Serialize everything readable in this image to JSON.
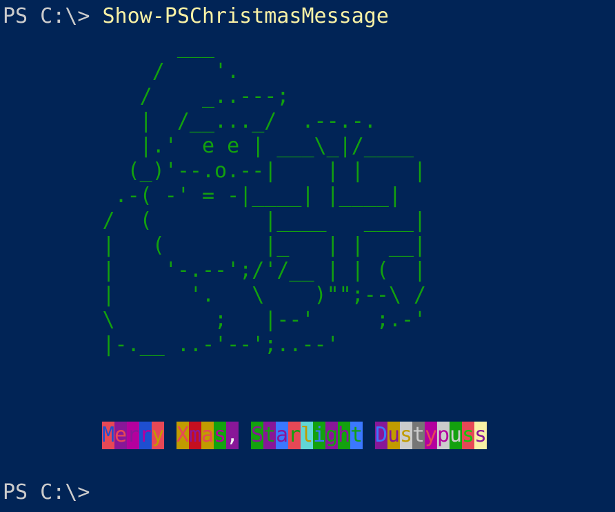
{
  "terminal": {
    "background": "#012456",
    "prompt": "PS C:\\>",
    "command": "Show-PSChristmasMessage",
    "art_color": "#13a10e",
    "art_lines": [
      "              ___",
      "            /    '.",
      "           /    _..---;",
      "           |  /__..._/  .--.-.",
      "           |.'  e e | ___\\_|/____",
      "          (_)'--.o.--|    | |    |",
      "         .-( -' = -|____| |____|",
      "        /  (         |____   ____|",
      "        |   (        |_   | |  __|",
      "        |    '-.--';/'/__ | | (  |",
      "        |      '.   \\    )\"\";--\\ /",
      "        \\        ;   |--'     ;.-'",
      "        |-.__ ..-'--';..--'"
    ],
    "message": [
      {
        "ch": "M",
        "fg": "#1e4fd0",
        "bg": "#e74856"
      },
      {
        "ch": "e",
        "fg": "#e74856",
        "bg": "#881798"
      },
      {
        "ch": "r",
        "fg": "#881798",
        "bg": "#b4009e"
      },
      {
        "ch": "r",
        "fg": "#b4009e",
        "bg": "#1e4fd0"
      },
      {
        "ch": "y",
        "fg": "#c19c00",
        "bg": "#e74856"
      },
      {
        "ch": " ",
        "fg": "#cccccc",
        "bg": "transparent"
      },
      {
        "ch": "X",
        "fg": "#e74856",
        "bg": "#c19c00"
      },
      {
        "ch": "m",
        "fg": "#881798",
        "bg": "#c50f1f"
      },
      {
        "ch": "a",
        "fg": "#e74856",
        "bg": "#c19c00"
      },
      {
        "ch": "s",
        "fg": "#b4009e",
        "bg": "#13a10e"
      },
      {
        "ch": ",",
        "fg": "#f2f2f2",
        "bg": "#881798"
      },
      {
        "ch": " ",
        "fg": "#cccccc",
        "bg": "transparent"
      },
      {
        "ch": "S",
        "fg": "#881798",
        "bg": "#13a10e"
      },
      {
        "ch": "t",
        "fg": "#13a10e",
        "bg": "#881798"
      },
      {
        "ch": "a",
        "fg": "#881798",
        "bg": "#3b78ff"
      },
      {
        "ch": "r",
        "fg": "#13a10e",
        "bg": "#e74856"
      },
      {
        "ch": "l",
        "fg": "#c19c00",
        "bg": "#61d6d6"
      },
      {
        "ch": "i",
        "fg": "#3b78ff",
        "bg": "#13a10e"
      },
      {
        "ch": "g",
        "fg": "#13a10e",
        "bg": "#881798"
      },
      {
        "ch": "h",
        "fg": "#881798",
        "bg": "#13a10e"
      },
      {
        "ch": "t",
        "fg": "#13a10e",
        "bg": "#3b78ff"
      },
      {
        "ch": " ",
        "fg": "#cccccc",
        "bg": "transparent"
      },
      {
        "ch": "D",
        "fg": "#3b78ff",
        "bg": "#881798"
      },
      {
        "ch": "u",
        "fg": "#881798",
        "bg": "#c19c00"
      },
      {
        "ch": "s",
        "fg": "#c19c00",
        "bg": "#cccccc"
      },
      {
        "ch": "t",
        "fg": "#cccccc",
        "bg": "#767676"
      },
      {
        "ch": "y",
        "fg": "#e74856",
        "bg": "#b4009e"
      },
      {
        "ch": "p",
        "fg": "#b4009e",
        "bg": "#cccccc"
      },
      {
        "ch": "u",
        "fg": "#cccccc",
        "bg": "#13a10e"
      },
      {
        "ch": "s",
        "fg": "#16c60c",
        "bg": "#e74856"
      },
      {
        "ch": "s",
        "fg": "#881798",
        "bg": "#f9f1a5"
      }
    ]
  }
}
